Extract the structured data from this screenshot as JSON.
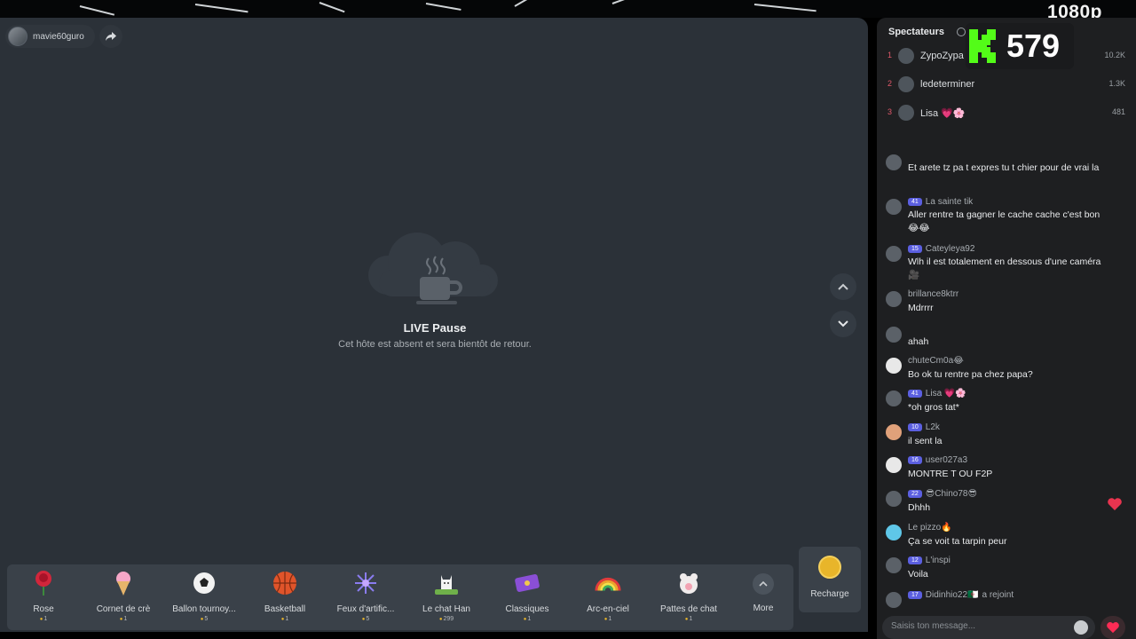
{
  "stream": {
    "quality": "1080p"
  },
  "host": {
    "name": "mavie60guro"
  },
  "pause": {
    "title": "LIVE Pause",
    "subtitle": "Cet hôte est absent et sera bientôt de retour."
  },
  "gifts": [
    {
      "name": "Rose",
      "price": "1"
    },
    {
      "name": "Cornet de crè",
      "price": "1"
    },
    {
      "name": "Ballon tournoy...",
      "price": "5"
    },
    {
      "name": "Basketball",
      "price": "1"
    },
    {
      "name": "Feux d'artific...",
      "price": "5"
    },
    {
      "name": "Le chat Han",
      "price": "299"
    },
    {
      "name": "Classiques",
      "price": "1"
    },
    {
      "name": "Arc-en-ciel",
      "price": "1"
    },
    {
      "name": "Pattes de chat",
      "price": "1"
    }
  ],
  "more_label": "More",
  "recharge_label": "Recharge",
  "sidebar": {
    "title": "Spectateurs",
    "viewers": [
      {
        "rank": "1",
        "name": "ZypoZypa",
        "count": "10.2K"
      },
      {
        "rank": "2",
        "name": "ledeterminer",
        "count": "1.3K"
      },
      {
        "rank": "3",
        "name": "Lisa 💗🌸",
        "count": "481"
      }
    ]
  },
  "kick": {
    "count": "579"
  },
  "chat": [
    {
      "user": "",
      "badge": "",
      "text": "Et arete tz pa t expres tu t chier pour de vrai la"
    },
    {
      "user": "La sainte tik",
      "badge": "41",
      "text": "Aller rentre ta gagner le cache cache c'est bon 😂😂"
    },
    {
      "user": "Cateyleya92",
      "badge": "15",
      "text": "Wlh il est totalement en dessous d'une caméra 🎥"
    },
    {
      "user": "brillance8ktrr",
      "badge": "",
      "text": "Mdrrrr"
    },
    {
      "user": "",
      "badge": "",
      "text": "ahah"
    },
    {
      "user": "chuteCm0a😂",
      "badge": "",
      "text": "Bo ok tu rentre pa chez papa?"
    },
    {
      "user": "Lisa 💗🌸",
      "badge": "41",
      "text": "*oh gros tat*"
    },
    {
      "user": "L2k",
      "badge": "10",
      "text": "il sent la"
    },
    {
      "user": "user027a3",
      "badge": "16",
      "text": "MONTRE T OU F2P"
    },
    {
      "user": "😎Chino78😎",
      "badge": "22",
      "text": "Dhhh"
    },
    {
      "user": "Le pizzo🔥",
      "badge": "",
      "text": "Ça se voit ta tarpin peur"
    },
    {
      "user": "L'inspi",
      "badge": "12",
      "text": "Voila"
    },
    {
      "user": "Didinhio22🇩🇿",
      "badge": "17",
      "text": "a rejoint"
    }
  ],
  "input": {
    "placeholder": "Saisis ton message..."
  },
  "colors": {
    "accent": "#fe2c55",
    "kick_green": "#53fc18",
    "coin": "#e8b52a"
  }
}
